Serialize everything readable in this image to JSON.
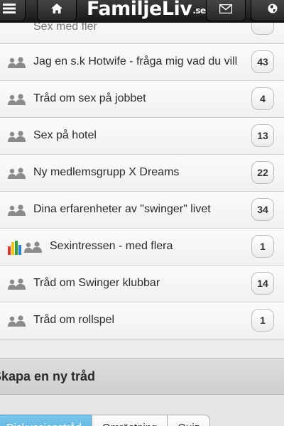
{
  "header": {
    "logo_text": "FamiljeLiv",
    "logo_suffix": ".se",
    "icons": [
      "menu-icon",
      "home-icon",
      "mail-icon",
      "globe-icon"
    ]
  },
  "threads": [
    {
      "title": "Sex med fler",
      "count": "",
      "icon": "group-icon"
    },
    {
      "title": "Jag en s.k Hotwife - fråga mig vad du vill",
      "count": "43",
      "icon": "group-icon"
    },
    {
      "title": "Tråd om sex på jobbet",
      "count": "4",
      "icon": "group-icon"
    },
    {
      "title": "Sex på hotel",
      "count": "13",
      "icon": "group-icon"
    },
    {
      "title": "Ny medlemsgrupp X Dreams",
      "count": "22",
      "icon": "group-icon"
    },
    {
      "title": "Dina erfarenheter av \"swinger\" livet",
      "count": "34",
      "icon": "group-icon"
    },
    {
      "title": "Sexintressen - med flera",
      "count": "1",
      "icon": "poll-group-icon"
    },
    {
      "title": "Tråd om Swinger klubbar",
      "count": "14",
      "icon": "group-icon"
    },
    {
      "title": "Tråd om rollspel",
      "count": "1",
      "icon": "group-icon"
    }
  ],
  "create": {
    "title": "Skapa en ny tråd",
    "tabs": [
      "Diskussionstråd",
      "Omröstning",
      "Quiz"
    ]
  },
  "colors": {
    "header_bg": "#1f1f1f",
    "active_tab": "#4aa6d6",
    "poll_bars": [
      "#e2342b",
      "#f2c31b",
      "#2f9e3e",
      "#2d7fd1"
    ]
  }
}
